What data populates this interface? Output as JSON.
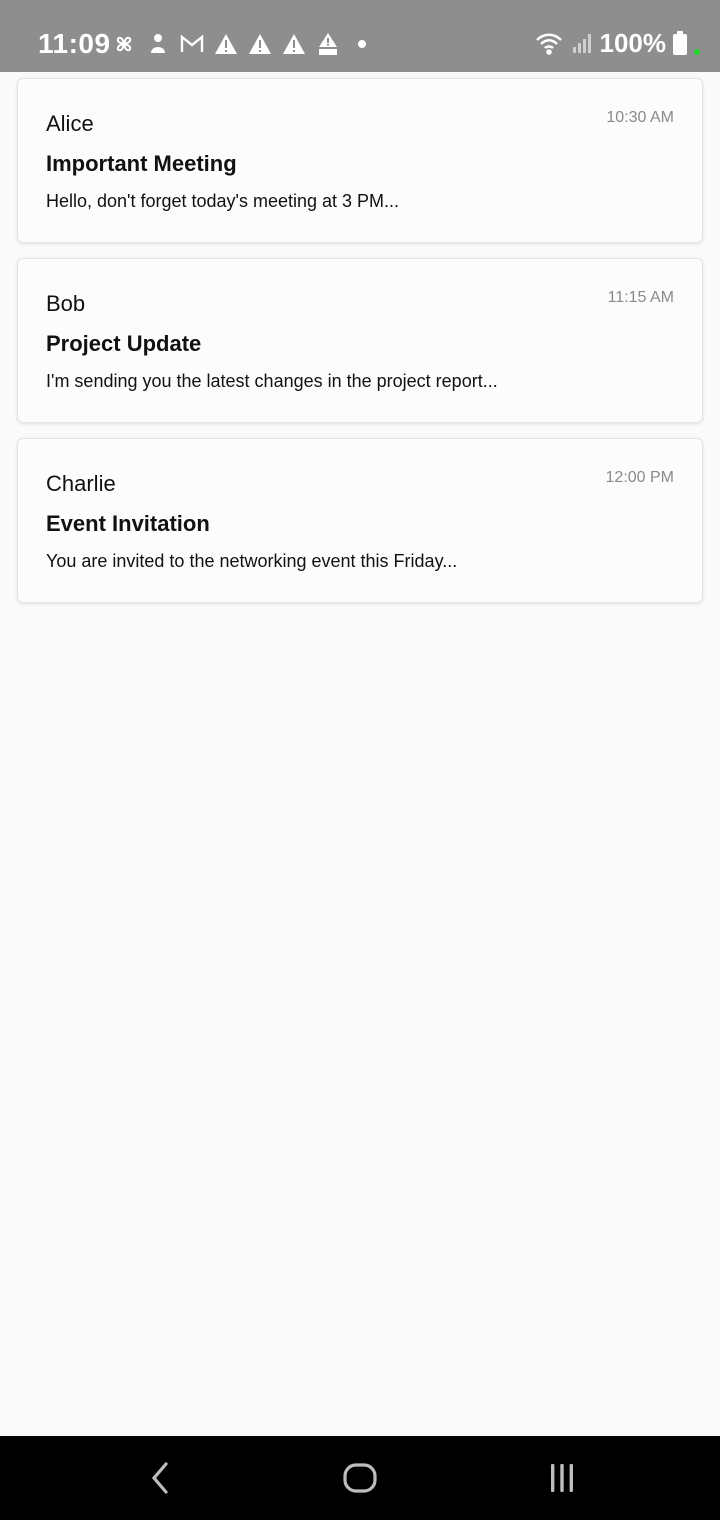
{
  "status_bar": {
    "time": "11:09",
    "battery": "100%",
    "icons": [
      "fan-icon",
      "app-icon",
      "gmail-icon",
      "warning-icon",
      "warning-icon",
      "warning-icon",
      "mm-warning-icon",
      "dot-icon"
    ],
    "right_icons": [
      "wifi-icon",
      "signal-icon",
      "battery-icon"
    ]
  },
  "emails": [
    {
      "sender": "Alice",
      "time": "10:30 AM",
      "subject": "Important Meeting",
      "preview": "Hello, don't forget today's meeting at 3 PM..."
    },
    {
      "sender": "Bob",
      "time": "11:15 AM",
      "subject": "Project Update",
      "preview": "I'm sending you the latest changes in the project report..."
    },
    {
      "sender": "Charlie",
      "time": "12:00 PM",
      "subject": "Event Invitation",
      "preview": "You are invited to the networking event this Friday..."
    }
  ],
  "nav": {
    "buttons": [
      "back-icon",
      "home-icon",
      "recents-icon"
    ]
  },
  "colors": {
    "status_bar_bg": "#8e8e8e",
    "page_bg": "#fafafa",
    "nav_bar_bg": "#000000",
    "timestamp": "#8a8a8a",
    "charging_dot": "#22d62a"
  }
}
